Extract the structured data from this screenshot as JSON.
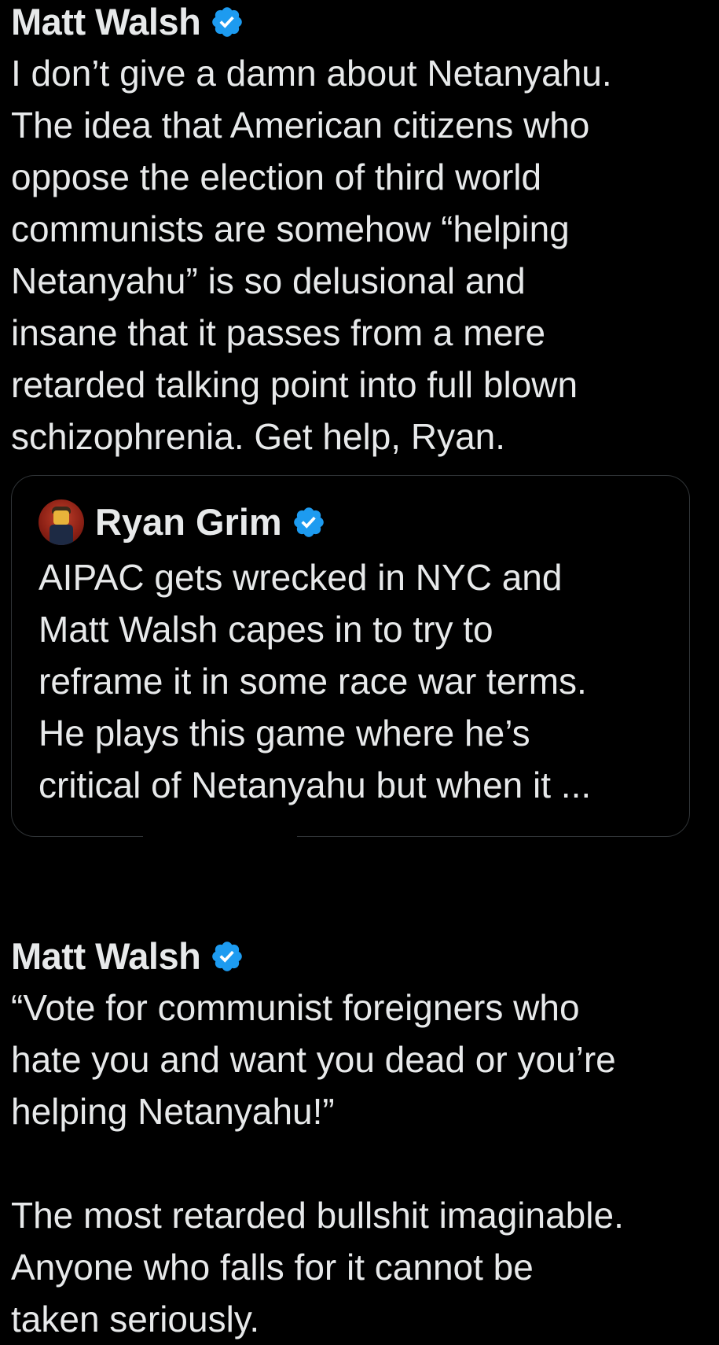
{
  "posts": [
    {
      "author": "Matt Walsh",
      "text": "I don’t give a damn about Netanyahu.\nThe idea that American citizens who\noppose the election of third world\ncommunists are somehow “helping\nNetanyahu” is so delusional and\ninsane that it passes from a mere\nretarded talking point into full blown\nschizophrenia. Get help, Ryan.",
      "quoted_post": {
        "author": "Ryan Grim",
        "text": "AIPAC gets wrecked in NYC and\nMatt Walsh capes in to try to\nreframe it in some race war terms.\nHe plays this game where he’s\ncritical of Netanyahu but when it ..."
      }
    },
    {
      "author": "Matt Walsh",
      "text": "“Vote for communist foreigners who\nhate you and want you dead or you’re\nhelping Netanyahu!”\n\nThe most retarded bullshit imaginable.\nAnyone who falls for it cannot be\ntaken seriously."
    }
  ],
  "icons": {
    "verified": "verified-badge-icon",
    "avatar": "ryan-grim-avatar"
  },
  "colors": {
    "background": "#000000",
    "text": "#e7e9ea",
    "verified_blue": "#1d9bf0",
    "card_border": "#2f3336"
  }
}
